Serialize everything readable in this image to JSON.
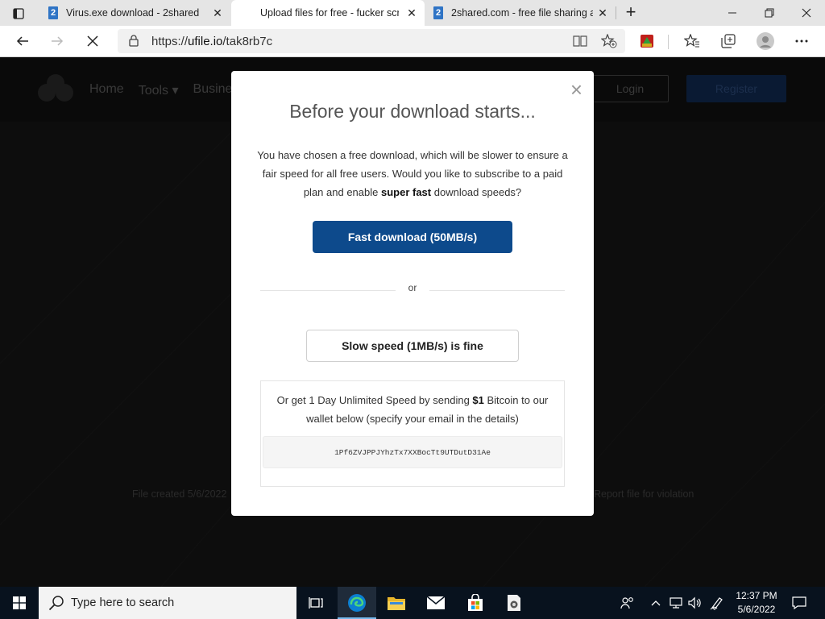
{
  "browser": {
    "tabs": [
      {
        "title": "Virus.exe download - 2shared",
        "favicon": "2"
      },
      {
        "title": "Upload files for free - fucker scri",
        "favicon": ""
      },
      {
        "title": "2shared.com - free file sharing a",
        "favicon": "2"
      }
    ],
    "new_tab_label": "+",
    "url_scheme": "https://",
    "url_host": "ufile.io",
    "url_path": "/tak8rb7c"
  },
  "site": {
    "nav": [
      "Home",
      "Tools ▾",
      "Busine"
    ],
    "login_label": "Login",
    "register_label": "Register",
    "file_created": "File created  5/6/2022",
    "report_label": "Report file for violation"
  },
  "modal": {
    "close_label": "×",
    "title": "Before your download starts...",
    "text_part1": "You have chosen a free download, which will be slower to ensure a fair speed for all free users. Would you like to subscribe to a paid plan and enable ",
    "text_bold": "super fast",
    "text_part2": " download speeds?",
    "fast_button": "Fast download (50MB/s)",
    "or_label": "or",
    "slow_button": "Slow speed (1MB/s) is fine",
    "crypto_part1": "Or get 1 Day Unlimited Speed by sending ",
    "crypto_bold": "$1",
    "crypto_part2": " Bitcoin to our wallet below (specify your email in the details)",
    "wallet_address": "1Pf6ZVJPPJYhzTx7XXBocTt9UTDutD31Ae"
  },
  "taskbar": {
    "search_placeholder": "Type here to search",
    "time": "12:37 PM",
    "date": "5/6/2022"
  },
  "colors": {
    "primary_button": "#0d4a8c",
    "taskbar_bg": "#08121e"
  }
}
